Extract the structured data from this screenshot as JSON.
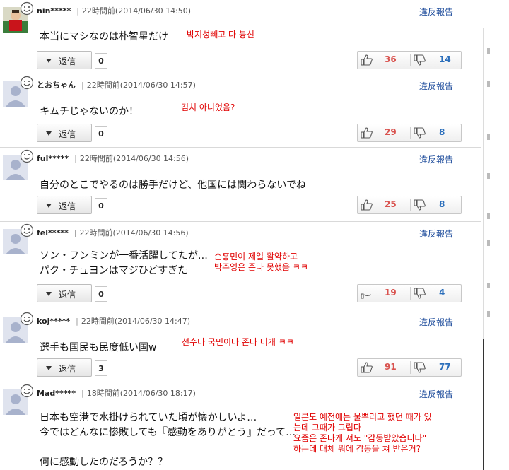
{
  "report_label": "違反報告",
  "reply_label": "返信",
  "comments": [
    {
      "user": "nin*****",
      "time": "22時間前(2014/06/30 14:50)",
      "lines": [
        "本当にマシなのは朴智星だけ"
      ],
      "korean": [
        "박지성빼고 다 븅신"
      ],
      "reply_count": "0",
      "likes": "36",
      "dislikes": "14",
      "avatar": "photo"
    },
    {
      "user": "とおちゃん",
      "time": "22時間前(2014/06/30 14:57)",
      "lines": [
        "キムチじゃないのか！"
      ],
      "korean": [
        "김치 아니었음?"
      ],
      "reply_count": "0",
      "likes": "29",
      "dislikes": "8",
      "avatar": "default"
    },
    {
      "user": "ful*****",
      "time": "22時間前(2014/06/30 14:56)",
      "lines": [
        "自分のとこでやるのは勝手だけど、他国には関わらないでね"
      ],
      "korean": [],
      "reply_count": "0",
      "likes": "25",
      "dislikes": "8",
      "avatar": "default"
    },
    {
      "user": "fel*****",
      "time": "22時間前(2014/06/30 14:56)",
      "lines": [
        "ソン・フンミンが一番活躍してたが…",
        "パク・チュヨンはマジひどすぎた"
      ],
      "korean": [
        "손흥민이 제일 활약하고",
        "박주영은 존나 못했음 ㅋㅋ"
      ],
      "reply_count": "0",
      "likes": "19",
      "dislikes": "4",
      "avatar": "default"
    },
    {
      "user": "koj*****",
      "time": "22時間前(2014/06/30 14:47)",
      "lines": [
        "選手も国民も民度低い国w"
      ],
      "korean": [
        "선수나 국민이나 존나 미개 ㅋㅋ"
      ],
      "reply_count": "3",
      "likes": "91",
      "dislikes": "77",
      "avatar": "default"
    },
    {
      "user": "Mad*****",
      "time": "18時間前(2014/06/30 18:17)",
      "lines": [
        "日本も空港で水掛けられていた頃が懐かしいよ…",
        "今ではどんなに惨敗しても『感動をありがとう』だって…",
        "",
        "何に感動したのだろうか？？"
      ],
      "korean": [
        "일본도 예전에는 물뿌리고 했던 때가 있",
        "는데 그때가 그립다",
        "요즘은 존나게 져도 \"감동받았습니다\"",
        "하는데 대체 뭐에 감동을 쳐 받은거?"
      ],
      "reply_count": "",
      "likes": "",
      "dislikes": "",
      "avatar": "default"
    }
  ]
}
